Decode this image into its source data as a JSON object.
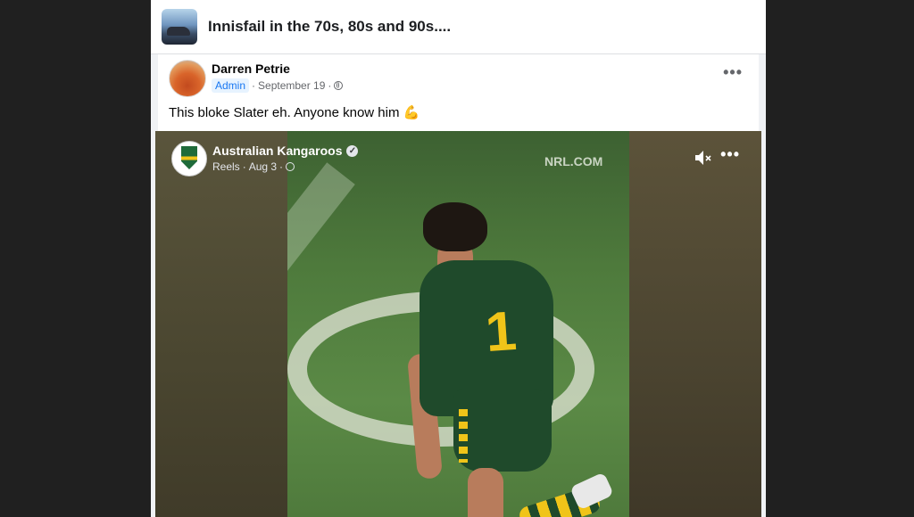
{
  "group": {
    "title": "Innisfail in the 70s, 80s and 90s...."
  },
  "post": {
    "author": "Darren Petrie",
    "role_badge": "Admin",
    "date": "September 19",
    "text": "This bloke Slater eh. Anyone know him",
    "emoji_icon": "flexed-biceps-icon",
    "more_label": "•••"
  },
  "reel": {
    "page_name": "Australian Kangaroos",
    "type": "Reels",
    "date": "Aug 3",
    "watermark": "NRL.COM",
    "jersey_number": "1",
    "more_label": "•••",
    "muted": true
  },
  "colors": {
    "accent": "#1877f2",
    "background": "#f0f2f5"
  }
}
